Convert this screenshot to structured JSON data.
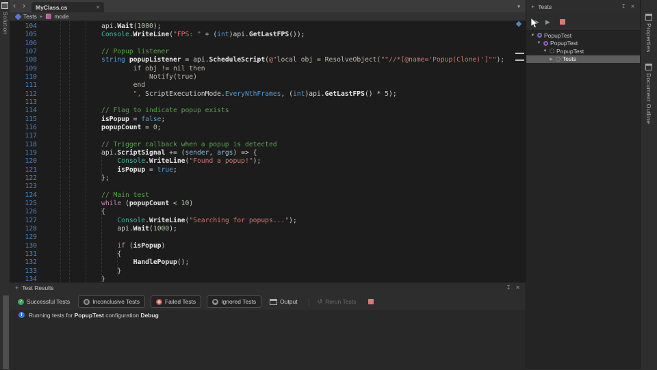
{
  "left_dock": {
    "label": "Solution"
  },
  "tab_bar": {
    "active_tab": "MyClass.cs"
  },
  "breadcrumb": {
    "item1": "Tests",
    "item2": "mode"
  },
  "editor": {
    "lines": [
      {
        "n": 104,
        "i": 12,
        "t": [
          [
            "pl",
            "api."
          ],
          [
            "m",
            "Wait"
          ],
          [
            "pl",
            "("
          ],
          [
            "num",
            "1000"
          ],
          [
            "pl",
            ");"
          ]
        ]
      },
      {
        "n": 105,
        "i": 12,
        "t": [
          [
            "cls",
            "Console"
          ],
          [
            "pl",
            "."
          ],
          [
            "m",
            "WriteLine"
          ],
          [
            "pl",
            "("
          ],
          [
            "str",
            "\"FPS: \""
          ],
          [
            "pl",
            " + ("
          ],
          [
            "kw",
            "int"
          ],
          [
            "pl",
            ")api."
          ],
          [
            "m",
            "GetLastFPS"
          ],
          [
            "pl",
            "());"
          ]
        ]
      },
      {
        "n": 106,
        "i": 0,
        "t": []
      },
      {
        "n": 107,
        "i": 12,
        "t": [
          [
            "com",
            "// Popup listener"
          ]
        ]
      },
      {
        "n": 108,
        "i": 12,
        "t": [
          [
            "kw",
            "string"
          ],
          [
            "pl",
            " "
          ],
          [
            "m",
            "popupListener"
          ],
          [
            "pl",
            " = api."
          ],
          [
            "m",
            "ScheduleScript"
          ],
          [
            "pl",
            "("
          ],
          [
            "str",
            "@\""
          ],
          [
            "vstr",
            "local obj = ResolveObject("
          ],
          [
            "str",
            "\"\"//*[@name='Popup(Clone)']\"\""
          ],
          [
            "vstr",
            ");"
          ]
        ]
      },
      {
        "n": 109,
        "i": 20,
        "t": [
          [
            "vstr",
            "if obj != nil then"
          ]
        ]
      },
      {
        "n": 110,
        "i": 24,
        "t": [
          [
            "vstr",
            "Notify(true)"
          ]
        ]
      },
      {
        "n": 111,
        "i": 20,
        "t": [
          [
            "vstr",
            "end"
          ]
        ]
      },
      {
        "n": 112,
        "i": 20,
        "t": [
          [
            "str",
            "\", "
          ],
          [
            "pl",
            "ScriptExecutionMode."
          ],
          [
            "kw",
            "EveryNthFrames"
          ],
          [
            "pl",
            ", ("
          ],
          [
            "kw",
            "int"
          ],
          [
            "pl",
            ")api."
          ],
          [
            "m",
            "GetLastFPS"
          ],
          [
            "pl",
            "() * "
          ],
          [
            "num",
            "5"
          ],
          [
            "pl",
            ");"
          ]
        ]
      },
      {
        "n": 113,
        "i": 0,
        "t": []
      },
      {
        "n": 114,
        "i": 12,
        "t": [
          [
            "com",
            "// Flag to indicate popup exists"
          ]
        ]
      },
      {
        "n": 115,
        "i": 12,
        "t": [
          [
            "m",
            "isPopup"
          ],
          [
            "pl",
            " = "
          ],
          [
            "kw",
            "false"
          ],
          [
            "pl",
            ";"
          ]
        ]
      },
      {
        "n": 116,
        "i": 12,
        "t": [
          [
            "m",
            "popupCount"
          ],
          [
            "pl",
            " = "
          ],
          [
            "num",
            "0"
          ],
          [
            "pl",
            ";"
          ]
        ]
      },
      {
        "n": 117,
        "i": 0,
        "t": []
      },
      {
        "n": 118,
        "i": 12,
        "t": [
          [
            "com",
            "// Trigger callback when a popup is detected"
          ]
        ]
      },
      {
        "n": 119,
        "i": 12,
        "t": [
          [
            "pl",
            "api."
          ],
          [
            "m",
            "ScriptSignal"
          ],
          [
            "pl",
            " += ("
          ],
          [
            "prm",
            "sender"
          ],
          [
            "pl",
            ", "
          ],
          [
            "prm",
            "args"
          ],
          [
            "pl",
            ") => {"
          ]
        ]
      },
      {
        "n": 120,
        "i": 16,
        "t": [
          [
            "cls",
            "Console"
          ],
          [
            "pl",
            "."
          ],
          [
            "m",
            "WriteLine"
          ],
          [
            "pl",
            "("
          ],
          [
            "str",
            "\"Found a popup!\""
          ],
          [
            "pl",
            ");"
          ]
        ]
      },
      {
        "n": 121,
        "i": 16,
        "t": [
          [
            "m",
            "isPopup"
          ],
          [
            "pl",
            " = "
          ],
          [
            "kw",
            "true"
          ],
          [
            "pl",
            ";"
          ]
        ]
      },
      {
        "n": 122,
        "i": 12,
        "t": [
          [
            "pl",
            "};"
          ]
        ]
      },
      {
        "n": 123,
        "i": 0,
        "t": []
      },
      {
        "n": 124,
        "i": 12,
        "t": [
          [
            "com",
            "// Main test"
          ]
        ]
      },
      {
        "n": 125,
        "i": 12,
        "t": [
          [
            "ctl",
            "while"
          ],
          [
            "pl",
            " ("
          ],
          [
            "m",
            "popupCount"
          ],
          [
            "pl",
            " < "
          ],
          [
            "num",
            "10"
          ],
          [
            "pl",
            ")"
          ]
        ]
      },
      {
        "n": 126,
        "i": 12,
        "t": [
          [
            "pl",
            "{"
          ]
        ]
      },
      {
        "n": 127,
        "i": 16,
        "t": [
          [
            "cls",
            "Console"
          ],
          [
            "pl",
            "."
          ],
          [
            "m",
            "WriteLine"
          ],
          [
            "pl",
            "("
          ],
          [
            "str",
            "\"Searching for popups...\""
          ],
          [
            "pl",
            ");"
          ]
        ]
      },
      {
        "n": 128,
        "i": 16,
        "t": [
          [
            "pl",
            "api."
          ],
          [
            "m",
            "Wait"
          ],
          [
            "pl",
            "("
          ],
          [
            "num",
            "1000"
          ],
          [
            "pl",
            ");"
          ]
        ]
      },
      {
        "n": 129,
        "i": 0,
        "t": []
      },
      {
        "n": 130,
        "i": 16,
        "t": [
          [
            "ctl",
            "if"
          ],
          [
            "pl",
            " ("
          ],
          [
            "m",
            "isPopup"
          ],
          [
            "pl",
            ")"
          ]
        ]
      },
      {
        "n": 131,
        "i": 16,
        "t": [
          [
            "pl",
            "{"
          ]
        ]
      },
      {
        "n": 132,
        "i": 20,
        "t": [
          [
            "m",
            "HandlePopup"
          ],
          [
            "pl",
            "();"
          ]
        ]
      },
      {
        "n": 133,
        "i": 16,
        "t": [
          [
            "pl",
            "}"
          ]
        ]
      },
      {
        "n": 134,
        "i": 12,
        "t": [
          [
            "pl",
            "}"
          ]
        ]
      }
    ]
  },
  "tests_panel": {
    "title": "Tests",
    "tree": [
      {
        "label": "PopupTest",
        "level": 0,
        "caret": "▼",
        "icon": "a",
        "selected": false
      },
      {
        "label": "PopupTest",
        "level": 1,
        "caret": "▼",
        "icon": "b",
        "selected": false
      },
      {
        "label": "PopupTest",
        "level": 2,
        "caret": "▼",
        "icon": "c",
        "selected": false
      },
      {
        "label": "Tests",
        "level": 3,
        "caret": "▶",
        "icon": "c",
        "selected": true
      }
    ]
  },
  "right_dock": {
    "tabs": [
      {
        "label": "Properties"
      },
      {
        "label": "Document Outline"
      }
    ]
  },
  "results_panel": {
    "title": "Test Results",
    "filters": [
      {
        "label": "Successful Tests",
        "icon": "success",
        "boxed": false
      },
      {
        "label": "Inconclusive Tests",
        "icon": "inconclusive",
        "boxed": true
      },
      {
        "label": "Failed Tests",
        "icon": "failed",
        "boxed": true
      },
      {
        "label": "Ignored Tests",
        "icon": "ignored",
        "boxed": true
      },
      {
        "label": "Output",
        "icon": "output",
        "boxed": false
      }
    ],
    "rerun_label": "Rerun Tests",
    "status": {
      "prefix": "Running tests for ",
      "target": "PopupTest",
      "middle": " configuration ",
      "config": "Debug"
    }
  },
  "colors": {
    "line_number_blue": "#4c83bd",
    "success_green": "#3fa35f",
    "fail_red": "#c94f4f",
    "stop_pink": "#dd7878",
    "info_blue": "#3a7bd5"
  }
}
